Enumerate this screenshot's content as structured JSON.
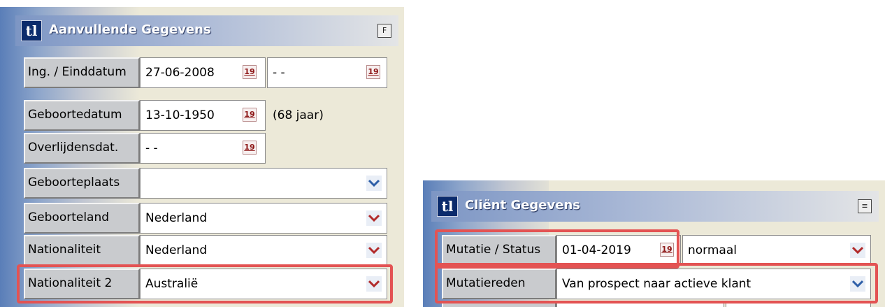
{
  "left_panel": {
    "logo": "tl",
    "title": "Aanvullende Gegevens",
    "title_button": "F",
    "rows": {
      "ing": {
        "label": "Ing. / Einddatum",
        "value": "27-06-2008",
        "calendar": "19",
        "value2": "-  -",
        "calendar2": "19"
      },
      "geboortedatum": {
        "label": "Geboortedatum",
        "value": "13-10-1950",
        "calendar": "19",
        "age": "(68 jaar)"
      },
      "overlijdensdat": {
        "label": "Overlijdensdat.",
        "value": "-  -",
        "calendar": "19"
      },
      "geboorteplaats": {
        "label": "Geboorteplaats",
        "value": ""
      },
      "geboorteland": {
        "label": "Geboorteland",
        "value": "Nederland"
      },
      "nationaliteit": {
        "label": "Nationaliteit",
        "value": "Nederland"
      },
      "nationaliteit2": {
        "label": "Nationaliteit 2",
        "value": "Australië"
      }
    }
  },
  "right_panel": {
    "logo": "tl",
    "title": "Cliënt Gegevens",
    "title_button": "≡",
    "rows": {
      "mutatie": {
        "label": "Mutatie / Status",
        "value": "01-04-2019",
        "calendar": "19",
        "status": "normaal"
      },
      "mutatiereden": {
        "label": "Mutatiereden",
        "value": "Van prospect naar actieve klant"
      }
    }
  },
  "colors": {
    "highlight": "#E35353",
    "label_bg": "#C9CBCE",
    "panel_bg": "#ECE9D8",
    "dropdown_arrow": "#B22B2B",
    "dropdown_arrow_blue": "#2E5FA8"
  },
  "icons": [
    "app-logo-icon",
    "calendar-icon",
    "chevron-down-icon",
    "panel-menu-icon"
  ]
}
